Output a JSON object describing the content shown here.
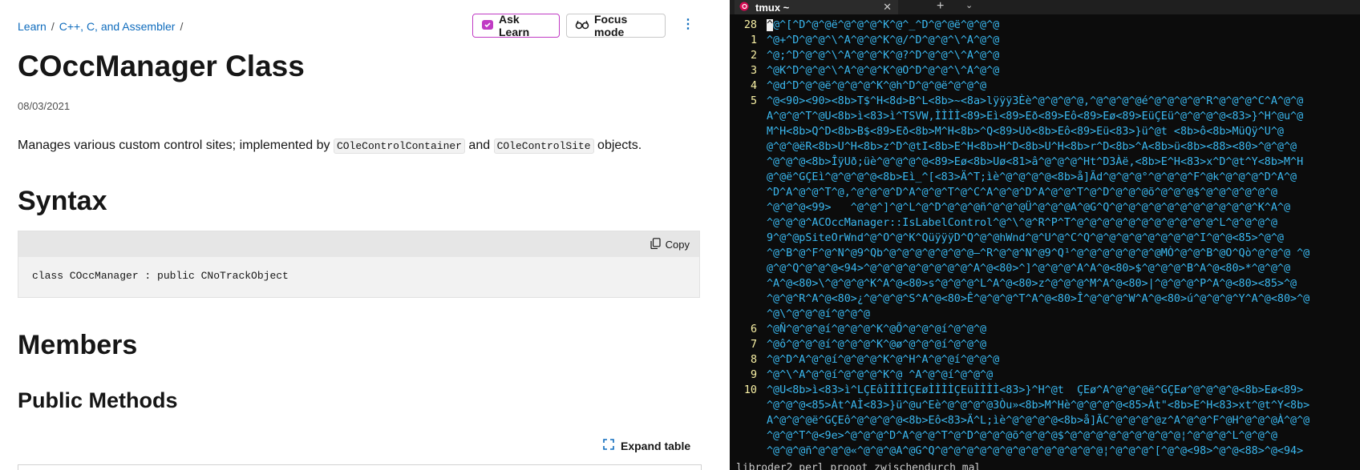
{
  "docs": {
    "breadcrumb": [
      "Learn",
      "C++, C, and Assembler"
    ],
    "breadcrumb_sep": "/",
    "ask_learn": "Ask Learn",
    "focus_mode": "Focus mode",
    "more_label": "⋮",
    "title": "COccManager Class",
    "date": "08/03/2021",
    "desc_prefix": "Manages various custom control sites; implemented by ",
    "desc_code1": "COleControlContainer",
    "desc_mid": " and ",
    "desc_code2": "COleControlSite",
    "desc_suffix": " objects.",
    "syntax_heading": "Syntax",
    "copy_label": "Copy",
    "code": "class COccManager : public CNoTrackObject",
    "members_heading": "Members",
    "public_methods_heading": "Public Methods",
    "expand_table": "Expand table",
    "colors": {
      "link": "#0f6cbd",
      "ask_border": "#c03bc4"
    }
  },
  "terminal": {
    "tab_title": "tmux ~",
    "new_tab": "+",
    "tab_dropdown": "⌄",
    "status_line": "libroder2 perl prooot zwischendurch mal",
    "colors": {
      "bg": "#0c0c0c",
      "text": "#3ab8f0",
      "linenum": "#f9f1a5"
    },
    "lines": [
      {
        "num": "28",
        "text": "^@^[^D^@^@ë^@^@^@^K^@^_^D^@^@ë^@^@^@"
      },
      {
        "num": "1",
        "text": "^@+^D^@^@^\\^A^@^@^K^@/^D^@^@^\\^A^@^@"
      },
      {
        "num": "2",
        "text": "^@;^D^@^@^\\^A^@^@^K^@?^D^@^@^\\^A^@^@"
      },
      {
        "num": "3",
        "text": "^@K^D^@^@^\\^A^@^@^K^@O^D^@^@^\\^A^@^@"
      },
      {
        "num": "4",
        "text": "^@d^D^@^@ë^@^@^@^K^@h^D^@^@ë^@^@^@"
      },
      {
        "num": "5",
        "text": "^@<90><90><8b>T$^H<8d>B^L<8b>~<8a>lÿÿÿ3Èè^@^@^@^@,^@^@^@^@é^@^@^@^@^R^@^@^@^C^A^@^@"
      },
      {
        "num": "",
        "text": "A^@^@^T^@U<8b>ì<83>ì^TSVW,ÌÌÌÌ<89>Eì<89>Eð<89>Eô<89>Eø<89>EüÇEü^@^@^@^@<83>}^H^@u^@"
      },
      {
        "num": "",
        "text": "M^H<8b>Q^D<8b>B$<89>Eð<8b>M^H<8b>^Q<89>Uð<8b>Eô<89>Eü<83>}ü^@t <8b>ô<8b>MüQÿ^U^@"
      },
      {
        "num": "",
        "text": "@^@^@ëR<8b>U^H<8b>z^D^@tI<8b>E^H<8b>H^D<8b>U^H<8b>r^D<8b>^A<8b>ü<8b><88><80>^@^@^@"
      },
      {
        "num": "",
        "text": "^@^@^@<8b>ÎÿUð;üè^@^@^@^@<89>Eø<8b>Uø<81>â^@^@^@^Ht^D3Àë,<8b>E^H<83>x^D^@t^Y<8b>M^H"
      },
      {
        "num": "",
        "text": "@^@ë^GÇEì^@^@^@^@<8b>Eì_^[<83>Ä^T;ìè^@^@^@^@<8b>å]Ãd^@^@^@°^@^@^@^F^@k^@^@^@^D^A^@"
      },
      {
        "num": "",
        "text": "^D^A^@^@^T^@,^@^@^@^D^A^@^@^T^@^C^A^@^@^D^A^@^@^T^@^D^@^@^@õ^@^@^@$^@^@^@^@^@^@"
      },
      {
        "num": "",
        "text": "^@^@^@<99>   ^@^@^]^@^L^@^D^@^@^@ñ^@^@^@Ü^@^@^@A^@G^Q^@^@^@^@^@^@^@^@^@^@^@^K^A^@"
      },
      {
        "num": "",
        "text": "^@^@^@^ACOccManager::IsLabelControl^@^\\^@^R^P^T^@^@^@^@^@^@^@^@^@^@^@^L^@^@^@^@"
      },
      {
        "num": "",
        "text": "9^@^@pSiteOrWnd^@^O^@^K^QüÿÿÿD^Q^@^@hWnd^@^U^@^C^Q^@^@^@^@^@^@^@^@^I^@^@<85>^@^@"
      },
      {
        "num": "",
        "text": "^@^B^@^F^@^N^@9^Qb^@^@^@^@^@^@^@—^R^@^@^N^@9^Q¹^@^@^@^@^@^@^@MÒ^@^@^B^@O^Qò^@^@^@ ^@"
      },
      {
        "num": "",
        "text": "@^@^Q^@^@^@<94>^@^@^@^@^@^@^@^@^A^@<80>^]^@^@^@^A^A^@<80>$^@^@^@^B^A^@<80>*^@^@^@"
      },
      {
        "num": "",
        "text": "^A^@<80>\\^@^@^@^K^A^@<80>s^@^@^@^L^A^@<80>z^@^@^@^M^A^@<80>|^@^@^@^P^A^@<80><85>^@"
      },
      {
        "num": "",
        "text": "^@^@^R^A^@<80>¿^@^@^@^S^A^@<80>Ê^@^@^@^T^A^@<80>Î^@^@^@^W^A^@<80>ú^@^@^@^Y^A^@<80>^@"
      },
      {
        "num": "",
        "text": "^@\\^@^@^@í^@^@^@"
      },
      {
        "num": "6",
        "text": "^@Ñ^@^@^@í^@^@^@^K^@Õ^@^@^@í^@^@^@"
      },
      {
        "num": "7",
        "text": "^@ô^@^@^@í^@^@^@^K^@ø^@^@^@í^@^@^@"
      },
      {
        "num": "8",
        "text": "^@^D^A^@^@í^@^@^@^K^@^H^A^@^@í^@^@^@"
      },
      {
        "num": "9",
        "text": "^@^\\^A^@^@í^@^@^@^K^@ ^A^@^@í^@^@^@"
      },
      {
        "num": "10",
        "text": "^@U<8b>ì<83>ì^LÇEôÌÌÌÌÇEøÌÌÌÌÇEüÌÌÌÌ<83>}^H^@t  ÇEø^A^@^@^@ë^GÇEø^@^@^@^@<8b>Eø<89>"
      },
      {
        "num": "",
        "text": "^@^@^@<85>Àt^AÌ<83>}ü^@u^Eè^@^@^@^@3Òu»<8b>M^Hè^@^@^@^@<85>Àt\"<8b>E^H<83>xt^@t^Y<8b>"
      },
      {
        "num": "",
        "text": "A^@^@^@ë^GÇEô^@^@^@^@<8b>Eô<83>Ä^L;ìè^@^@^@^@<8b>å]ÃC^@^@^@^@z^A^@^@^F^@H^@^@^@À^@^@"
      },
      {
        "num": "",
        "text": "^@^@^T^@<9e>^@^@^@^D^A^@^@^T^@^D^@^@^@õ^@^@^@$^@^@^@^@^@^@^@^@^@¦^@^@^@^L^@^@^@"
      },
      {
        "num": "",
        "text": "^@^@^@ñ^@^@^@«^@^@^@A^@G^Q^@^@^@^@^@^@^@^@^@^@^@^@^@¦^@^@^@^[^@^@<98>^@^@<88>^@<94>"
      }
    ]
  }
}
